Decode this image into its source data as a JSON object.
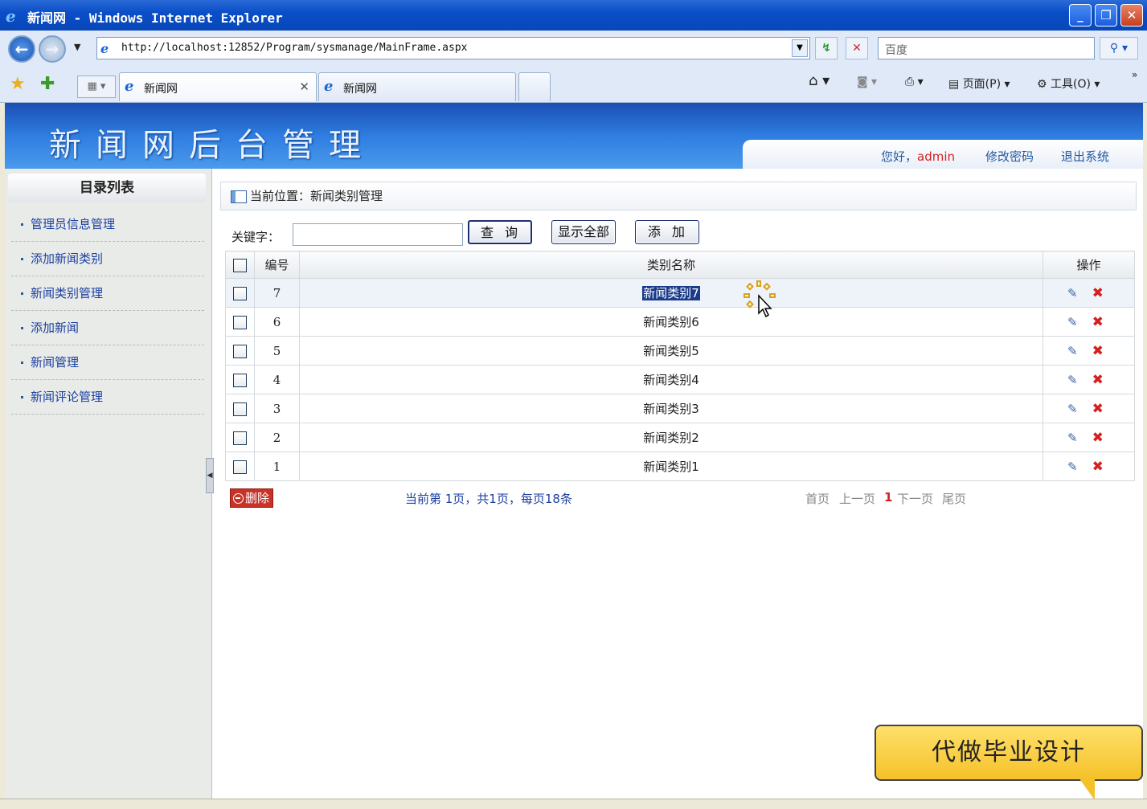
{
  "window": {
    "title": "新闻网 - Windows Internet Explorer"
  },
  "address": {
    "url": "http://localhost:12852/Program/sysmanage/MainFrame.aspx"
  },
  "search": {
    "placeholder": "百度"
  },
  "tabs": [
    {
      "label": "新闻网",
      "active": true
    },
    {
      "label": "新闻网",
      "active": false
    }
  ],
  "commands": {
    "page": "页面(P)",
    "tools": "工具(O)"
  },
  "banner": {
    "title": "新闻网后台管理",
    "greeting": "您好，",
    "username": "admin",
    "change_password": "修改密码",
    "logout": "退出系统"
  },
  "sidebar": {
    "header": "目录列表",
    "items": [
      {
        "label": "管理员信息管理"
      },
      {
        "label": "添加新闻类别"
      },
      {
        "label": "新闻类别管理"
      },
      {
        "label": "添加新闻"
      },
      {
        "label": "新闻管理"
      },
      {
        "label": "新闻评论管理"
      }
    ]
  },
  "main": {
    "breadcrumb": "当前位置：新闻类别管理",
    "keyword_label": "关键字：",
    "keyword_value": "",
    "query_button": "查询",
    "show_all_button": "显示全部",
    "add_button": "添加",
    "columns": [
      "编号",
      "类别名称",
      "操作"
    ],
    "rows": [
      {
        "id": "7",
        "name": "新闻类别7"
      },
      {
        "id": "6",
        "name": "新闻类别6"
      },
      {
        "id": "5",
        "name": "新闻类别5"
      },
      {
        "id": "4",
        "name": "新闻类别4"
      },
      {
        "id": "3",
        "name": "新闻类别3"
      },
      {
        "id": "2",
        "name": "新闻类别2"
      },
      {
        "id": "1",
        "name": "新闻类别1"
      }
    ],
    "delete_button": "删除",
    "page_info": "当前第 1页，共1页，每页18条",
    "pager": {
      "first": "首页",
      "prev": "上一页",
      "current": "1",
      "next": "下一页",
      "last": "尾页"
    }
  },
  "ad": {
    "text": "代做毕业设计"
  },
  "colors": {
    "title_bar": "#0a4ec8",
    "banner": "#2f7de0",
    "link": "#1a3fa0",
    "accent_red": "#d42020",
    "ad_yellow": "#f5c12a"
  }
}
